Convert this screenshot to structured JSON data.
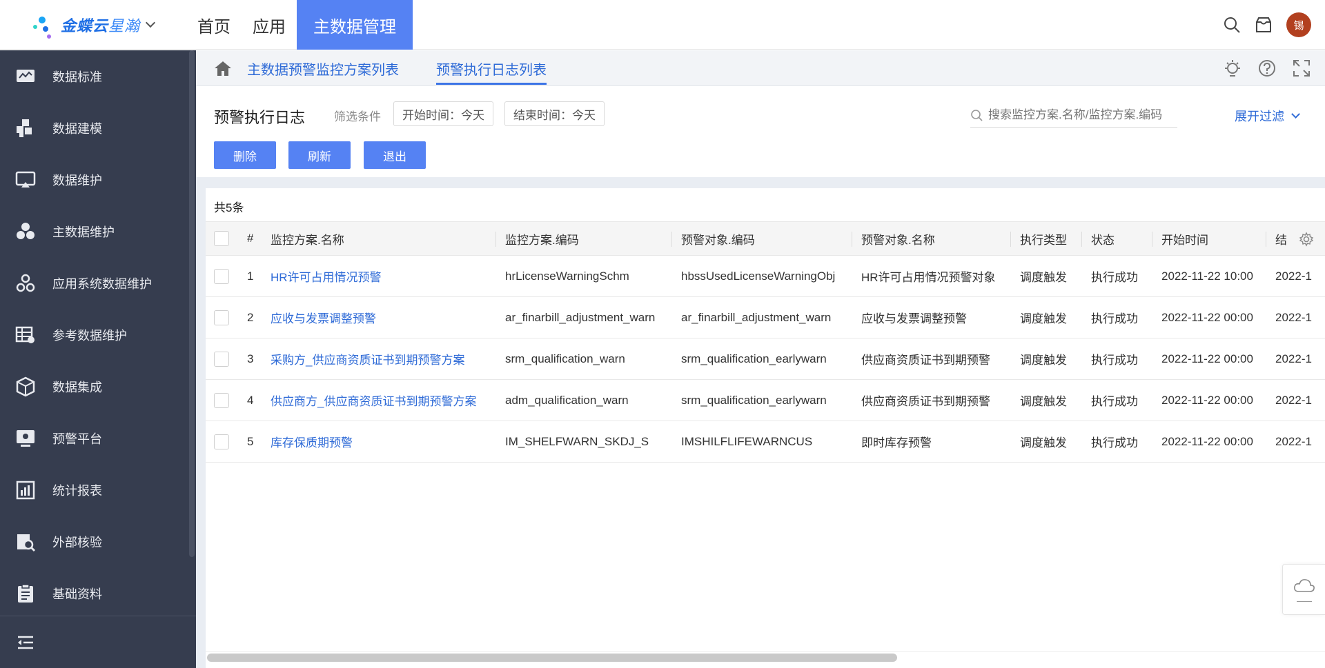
{
  "app": {
    "logo_name": "金蝶云",
    "logo_sub": "星瀚"
  },
  "nav": {
    "items": [
      {
        "label": "首页"
      },
      {
        "label": "应用"
      },
      {
        "label": "主数据管理"
      }
    ]
  },
  "user": {
    "avatar_text": "锡"
  },
  "sidebar": {
    "items": [
      {
        "label": "数据标准",
        "icon": "chart-monitor-icon"
      },
      {
        "label": "数据建模",
        "icon": "blocks-icon"
      },
      {
        "label": "数据维护",
        "icon": "screen-icon"
      },
      {
        "label": "主数据维护",
        "icon": "cluster-icon"
      },
      {
        "label": "应用系统数据维护",
        "icon": "nodes-icon"
      },
      {
        "label": "参考数据维护",
        "icon": "table-gear-icon"
      },
      {
        "label": "数据集成",
        "icon": "cube-icon"
      },
      {
        "label": "预警平台",
        "icon": "alert-screen-icon"
      },
      {
        "label": "统计报表",
        "icon": "report-icon"
      },
      {
        "label": "外部核验",
        "icon": "clipboard-search-icon"
      },
      {
        "label": "基础资料",
        "icon": "clipboard-list-icon"
      }
    ]
  },
  "tabs": [
    {
      "label": "主数据预警监控方案列表"
    },
    {
      "label": "预警执行日志列表"
    }
  ],
  "toolbar": {
    "title": "预警执行日志",
    "filter_label": "筛选条件",
    "chips": [
      {
        "label": "开始时间：今天"
      },
      {
        "label": "结束时间：今天"
      }
    ],
    "search_placeholder": "搜索监控方案.名称/监控方案.编码",
    "expand_label": "展开过滤",
    "buttons": {
      "delete": "删除",
      "refresh": "刷新",
      "exit": "退出"
    }
  },
  "grid": {
    "count": "共5条",
    "columns": {
      "index": "#",
      "scheme_name": "监控方案.名称",
      "scheme_code": "监控方案.编码",
      "target_code": "预警对象.编码",
      "target_name": "预警对象.名称",
      "exec_type": "执行类型",
      "status": "状态",
      "start_time": "开始时间",
      "end_time": "结"
    },
    "rows": [
      {
        "index": "1",
        "scheme_name": "HR许可占用情况预警",
        "scheme_code": "hrLicenseWarningSchm",
        "target_code": "hbssUsedLicenseWarningObj",
        "target_name": "HR许可占用情况预警对象",
        "exec_type": "调度触发",
        "status": "执行成功",
        "start_time": "2022-11-22 10:00",
        "end_time": "2022-1"
      },
      {
        "index": "2",
        "scheme_name": "应收与发票调整预警",
        "scheme_code": "ar_finarbill_adjustment_warn",
        "target_code": "ar_finarbill_adjustment_warn",
        "target_name": "应收与发票调整预警",
        "exec_type": "调度触发",
        "status": "执行成功",
        "start_time": "2022-11-22 00:00",
        "end_time": "2022-1"
      },
      {
        "index": "3",
        "scheme_name": "采购方_供应商资质证书到期预警方案",
        "scheme_code": "srm_qualification_warn",
        "target_code": "srm_qualification_earlywarn",
        "target_name": "供应商资质证书到期预警",
        "exec_type": "调度触发",
        "status": "执行成功",
        "start_time": "2022-11-22 00:00",
        "end_time": "2022-1"
      },
      {
        "index": "4",
        "scheme_name": "供应商方_供应商资质证书到期预警方案",
        "scheme_code": "adm_qualification_warn",
        "target_code": "srm_qualification_earlywarn",
        "target_name": "供应商资质证书到期预警",
        "exec_type": "调度触发",
        "status": "执行成功",
        "start_time": "2022-11-22 00:00",
        "end_time": "2022-1"
      },
      {
        "index": "5",
        "scheme_name": "库存保质期预警",
        "scheme_code": "IM_SHELFWARN_SKDJ_S",
        "target_code": "IMSHILFLIFEWARNCUS",
        "target_name": "即时库存预警",
        "exec_type": "调度触发",
        "status": "执行成功",
        "start_time": "2022-11-22 00:00",
        "end_time": "2022-1"
      }
    ]
  },
  "colors": {
    "accent": "#5582f3",
    "link": "#2f6bd7",
    "sidebar_bg": "#363d4f",
    "avatar_bg": "#b2401f"
  }
}
